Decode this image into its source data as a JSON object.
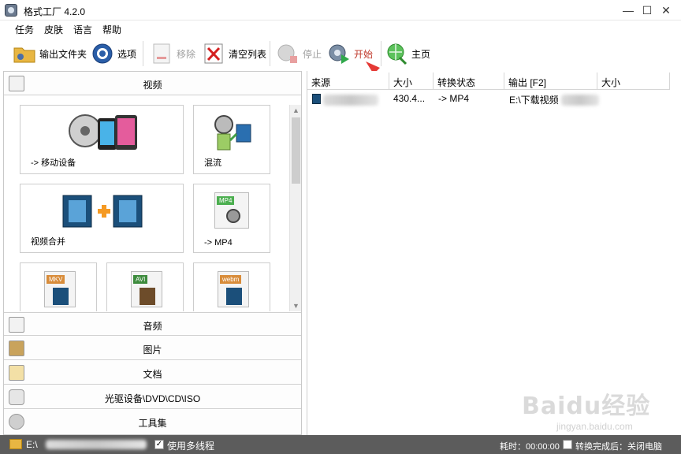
{
  "window": {
    "title": "格式工厂 4.2.0",
    "minimize": "—",
    "maximize": "☐",
    "close": "✕"
  },
  "menu": [
    "任务",
    "皮肤",
    "语言",
    "帮助"
  ],
  "toolbar": {
    "output_folder": "输出文件夹",
    "options": "选项",
    "remove": "移除",
    "clear_list": "清空列表",
    "stop": "停止",
    "start": "开始",
    "home": "主页"
  },
  "categories": {
    "video": "视频",
    "audio": "音频",
    "picture": "图片",
    "document": "文档",
    "optical": "光驱设备\\DVD\\CD\\ISO",
    "tools": "工具集"
  },
  "video_tiles": [
    {
      "label": "-> 移动设备"
    },
    {
      "label": "混流"
    },
    {
      "label": "视频合并"
    },
    {
      "label": "-> MP4"
    }
  ],
  "format_badges": {
    "mkv": "MKV",
    "avi": "AVI",
    "webm": "webm",
    "mp4": "MP4"
  },
  "file_list": {
    "headers": [
      "来源",
      "大小",
      "转换状态",
      "输出 [F2]",
      "大小"
    ],
    "rows": [
      {
        "source": "",
        "size": "430.4...",
        "status": "-> MP4",
        "output": "E:\\下载视频",
        "out_size": ""
      }
    ]
  },
  "statusbar": {
    "path": "E:\\",
    "multithread_label": "使用多线程",
    "multithread_checked": true,
    "elapsed": "耗时：00:00:00",
    "after_convert": "转换完成后：关闭电脑",
    "after_convert_checked": false
  },
  "watermark": {
    "brand": "Baidu经验",
    "url": "jingyan.baidu.com"
  },
  "colors": {
    "accent_red": "#e53935",
    "statusbar": "#5c5c5c"
  }
}
